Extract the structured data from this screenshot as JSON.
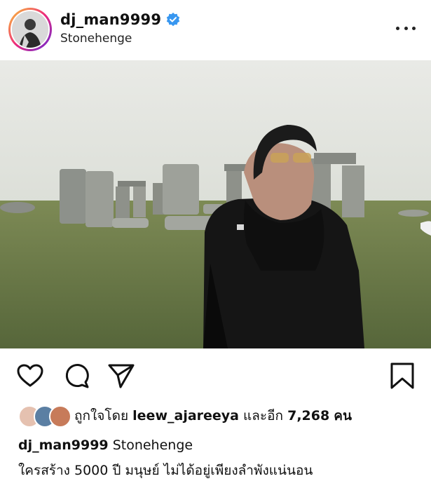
{
  "post": {
    "username": "dj_man9999",
    "location": "Stonehenge",
    "verified": true,
    "likes": {
      "prefix": "ถูกใจโดย",
      "liker": "leew_ajareeya",
      "middle": "และอีก",
      "count": "7,268",
      "suffix": "คน"
    },
    "caption": {
      "username": "dj_man9999",
      "text": "Stonehenge",
      "line2": "ใครสร้าง 5000 ปี มนุษย์ ไม่ได้อยู่เพียงลำพังแน่นอน"
    }
  },
  "icons": {
    "more": "more-options-icon",
    "like": "heart-icon",
    "comment": "comment-icon",
    "share": "share-icon",
    "save": "bookmark-icon",
    "verified": "verified-badge-icon"
  },
  "colors": {
    "verified": "#3897f0",
    "text": "#111111"
  }
}
